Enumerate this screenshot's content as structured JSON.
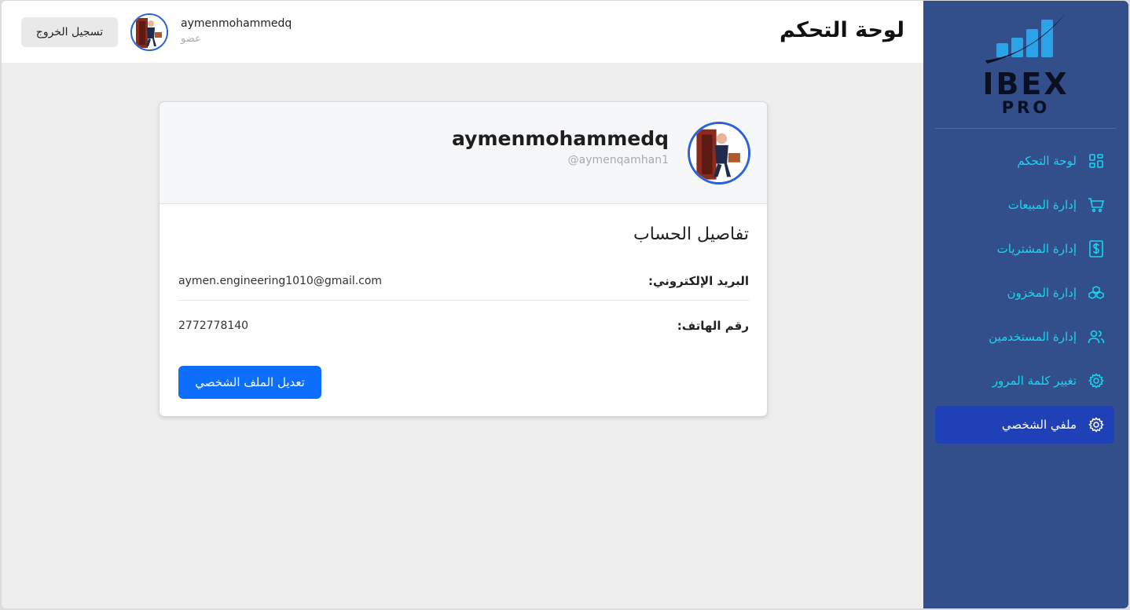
{
  "brand": {
    "title": "IBEX",
    "subtitle": "PRO",
    "colors": {
      "sidebar": "#324f8c",
      "accent": "#19d6ef",
      "active": "#2040b8",
      "primary": "#0d6efd"
    }
  },
  "header": {
    "page_title": "لوحة التحكم",
    "logout_label": "تسجيل الخروج",
    "username": "aymenmohammedq",
    "role": "عضو"
  },
  "sidebar": {
    "items": [
      {
        "label": "لوحة التحكم",
        "icon": "dashboard-grid-icon",
        "active": false
      },
      {
        "label": "إدارة المبيعات",
        "icon": "cart-icon",
        "active": false
      },
      {
        "label": "إدارة المشتريات",
        "icon": "dollar-receipt-icon",
        "active": false
      },
      {
        "label": "إدارة المخزون",
        "icon": "boxes-icon",
        "active": false
      },
      {
        "label": "إدارة المستخدمين",
        "icon": "users-icon",
        "active": false
      },
      {
        "label": "تغيير كلمة المرور",
        "icon": "gear-icon",
        "active": false
      },
      {
        "label": "ملفي الشخصي",
        "icon": "gear-icon",
        "active": true
      }
    ]
  },
  "profile": {
    "name": "aymenmohammedq",
    "handle": "@aymenqamhan1",
    "section_title": "تفاصيل الحساب",
    "email_label": "البريد الإلكتروني:",
    "email_value": "aymen.engineering1010@gmail.com",
    "phone_label": "رقم الهاتف:",
    "phone_value": "2772778140",
    "edit_label": "تعديل الملف الشخصي"
  }
}
